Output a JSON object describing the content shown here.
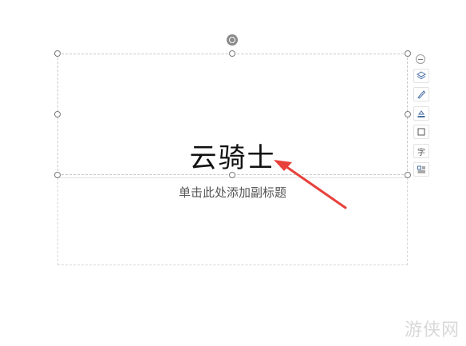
{
  "slide": {
    "title": "云骑士",
    "subtitle_placeholder": "单击此处添加副标题"
  },
  "toolbar": {
    "items": [
      "layers-icon",
      "pen-icon",
      "fill-icon",
      "border-icon",
      "text-icon",
      "text-wrap-icon"
    ],
    "char_label": "字"
  },
  "watermark": {
    "text": "游侠网"
  },
  "colors": {
    "arrow": "#e8403a",
    "border": "#c8c8c8"
  }
}
